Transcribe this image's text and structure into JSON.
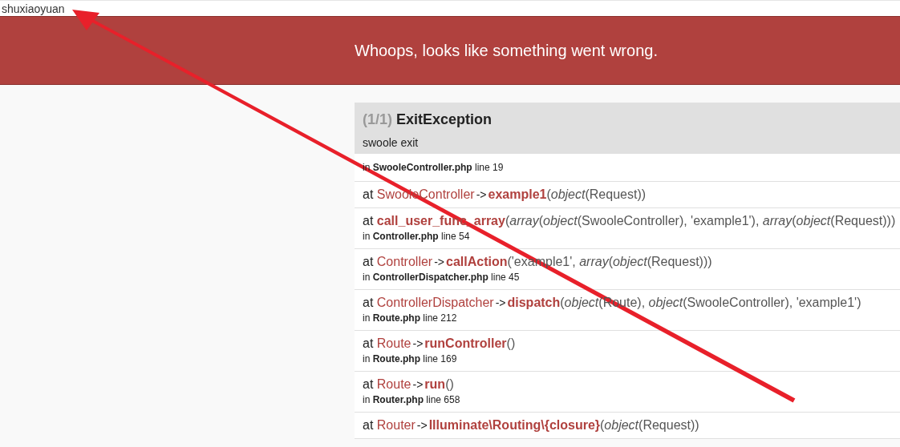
{
  "page_header": {
    "text": "shuxiaoyuan"
  },
  "banner": {
    "title": "Whoops, looks like something went wrong."
  },
  "exception": {
    "counter": "(1/1)",
    "name": "ExitException",
    "message": "swoole exit",
    "location": {
      "prefix": "in",
      "file": "SwooleController.php",
      "line": "line 19"
    }
  },
  "trace": [
    {
      "kind": "method",
      "at": "at",
      "class": "SwooleController",
      "arrow": "->",
      "method": "example1",
      "open": "(",
      "args": "*object*(Request))"
    },
    {
      "kind": "function",
      "at": "at",
      "method": "call_user_func_array",
      "open": "(",
      "args": "*array*(*object*(SwooleController), 'example1'), *array*(*object*(Request)))",
      "prefix": "in",
      "file": "Controller.php",
      "line": "line 54"
    },
    {
      "kind": "method",
      "at": "at",
      "class": "Controller",
      "arrow": "->",
      "method": "callAction",
      "open": "(",
      "args": "'example1', *array*(*object*(Request)))",
      "prefix": "in",
      "file": "ControllerDispatcher.php",
      "line": "line 45"
    },
    {
      "kind": "method",
      "at": "at",
      "class": "ControllerDispatcher",
      "arrow": "->",
      "method": "dispatch",
      "open": "(",
      "args": "*object*(Route), *object*(SwooleController), 'example1')",
      "prefix": "in",
      "file": "Route.php",
      "line": "line 212"
    },
    {
      "kind": "method",
      "at": "at",
      "class": "Route",
      "arrow": "->",
      "method": "runController",
      "open": "(",
      "args": ")",
      "prefix": "in",
      "file": "Route.php",
      "line": "line 169"
    },
    {
      "kind": "method",
      "at": "at",
      "class": "Route",
      "arrow": "->",
      "method": "run",
      "open": "(",
      "args": ")",
      "prefix": "in",
      "file": "Router.php",
      "line": "line 658"
    },
    {
      "kind": "method",
      "at": "at",
      "class": "Router",
      "arrow": "->",
      "method": "Illuminate\\Routing\\{closure}",
      "open": "(",
      "args": "*object*(Request))"
    }
  ]
}
